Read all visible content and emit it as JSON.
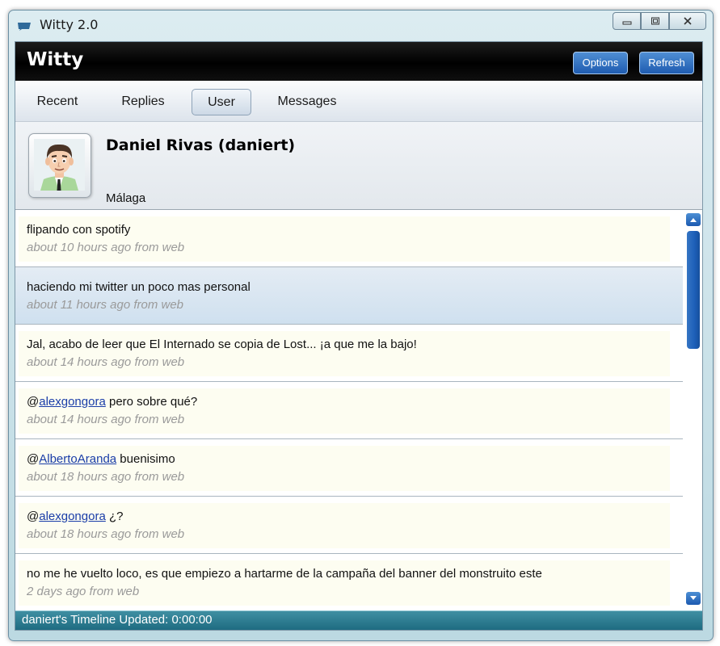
{
  "window": {
    "title": "Witty 2.0",
    "controls": {
      "minimize": "minimize-icon",
      "maximize": "maximize-icon",
      "close": "close-icon"
    }
  },
  "app": {
    "title": "Witty",
    "options_label": "Options",
    "refresh_label": "Refresh"
  },
  "tabs": [
    {
      "label": "Recent",
      "active": false
    },
    {
      "label": "Replies",
      "active": false
    },
    {
      "label": "User",
      "active": true
    },
    {
      "label": "Messages",
      "active": false
    }
  ],
  "profile": {
    "name": "Daniel Rivas (daniert)",
    "location": "Málaga",
    "avatar_icon": "cartoon-avatar-icon"
  },
  "tweets": [
    {
      "prefix": "",
      "mention": "",
      "text": "flipando con spotify",
      "meta": "about 10 hours ago from web",
      "selected": false
    },
    {
      "prefix": "",
      "mention": "",
      "text": "haciendo mi twitter un poco mas personal",
      "meta": "about 11 hours ago from web",
      "selected": true
    },
    {
      "prefix": "",
      "mention": "",
      "text": "Jal, acabo de leer que El Internado se copia de Lost... ¡a que me la bajo!",
      "meta": "about 14 hours ago from web",
      "selected": false
    },
    {
      "prefix": "@",
      "mention": "alexgongora",
      "text": " pero sobre qué?",
      "meta": "about 14 hours ago from web",
      "selected": false
    },
    {
      "prefix": "@",
      "mention": "AlbertoAranda",
      "text": " buenisimo",
      "meta": "about 18 hours ago from web",
      "selected": false
    },
    {
      "prefix": "@",
      "mention": "alexgongora",
      "text": " ¿?",
      "meta": "about 18 hours ago from web",
      "selected": false
    },
    {
      "prefix": "",
      "mention": "",
      "text": "no me he vuelto loco, es que empiezo a hartarme de la campaña del banner del monstruito este",
      "meta": "2 days ago from web",
      "selected": false
    }
  ],
  "status": {
    "text": "daniert's Timeline Updated: 0:00:00"
  },
  "colors": {
    "accent": "#1f5cb0",
    "link": "#1a3da8",
    "status_bar": "#2a7a8e",
    "selected_row": "#d6e4f1"
  }
}
